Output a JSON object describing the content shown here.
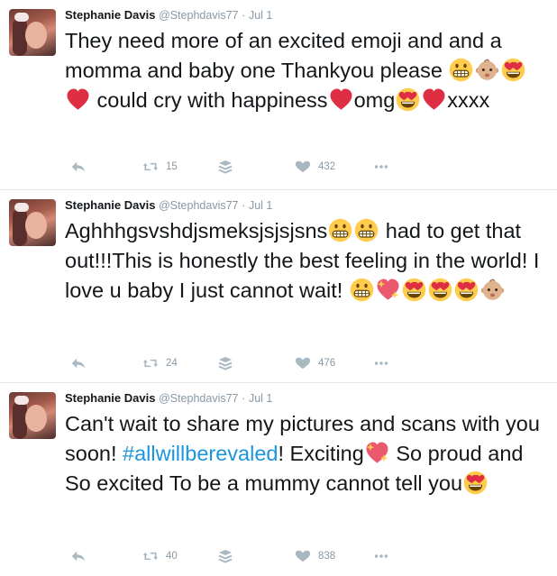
{
  "tweets": [
    {
      "name": "Stephanie Davis",
      "handle": "@Stephdavis77",
      "dot": "·",
      "date": "Jul 1",
      "text_1": "They need more of an excited emoji and and a momma and baby one Thankyou please",
      "text_2": "could cry with happiness",
      "text_3": "omg",
      "text_4": "xxxx",
      "retweets": "15",
      "likes": "432"
    },
    {
      "name": "Stephanie Davis",
      "handle": "@Stephdavis77",
      "dot": "·",
      "date": "Jul 1",
      "text_1": "Aghhhgsvshdjsmeksjsjsjsns",
      "text_2": "had to get that out!!!This is honestly the best feeling in the world! I love u baby I just cannot wait!",
      "retweets": "24",
      "likes": "476"
    },
    {
      "name": "Stephanie Davis",
      "handle": "@Stephdavis77",
      "dot": "·",
      "date": "Jul 1",
      "text_1": "Can't wait to share my pictures and scans with you soon!",
      "hashtag": "#allwillberevaled",
      "text_2": "! Exciting",
      "text_3": "So proud and So excited To be a mummy cannot tell you",
      "retweets": "40",
      "likes": "838"
    }
  ],
  "icons": {
    "grin": "grinning-face-emoji",
    "baby": "baby-emoji",
    "heart_eyes": "heart-eyes-emoji",
    "heart": "red-heart-emoji",
    "sparkle_heart": "sparkling-heart-emoji",
    "reply": "reply-icon",
    "retweet": "retweet-icon",
    "save": "save-icon",
    "like": "like-icon",
    "more": "more-icon"
  },
  "colors": {
    "text": "#14171a",
    "muted": "#8899a6",
    "link": "#1b95e0",
    "heart": "#e0245e",
    "emoji_yellow": "#ffcc4d"
  }
}
